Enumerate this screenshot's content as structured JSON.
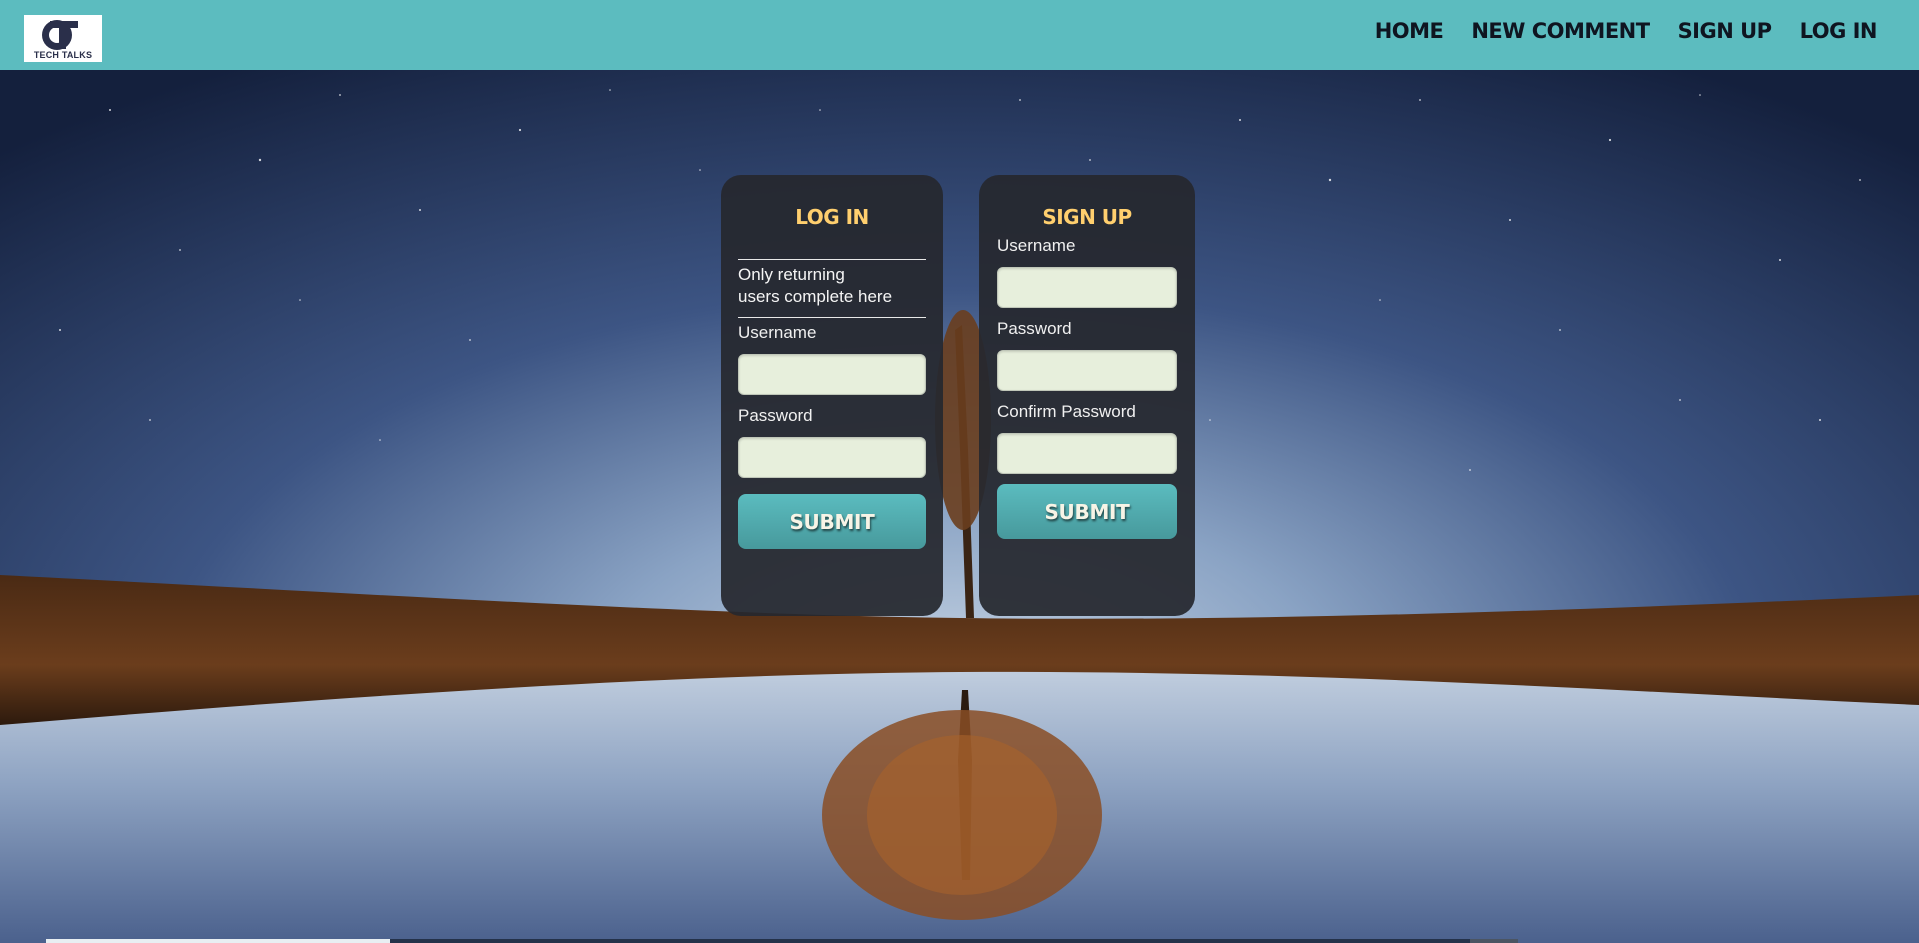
{
  "brand": {
    "logo_text": "TECH TALKS",
    "header_color": "#5cbcbf"
  },
  "nav": {
    "items": [
      {
        "label": "HOME"
      },
      {
        "label": "NEW COMMENT"
      },
      {
        "label": "SIGN UP"
      },
      {
        "label": "LOG IN"
      }
    ]
  },
  "login": {
    "title": "LOG IN",
    "note_line1": "Only returning",
    "note_line2": "users complete here",
    "username_label": "Username",
    "username_value": "",
    "password_label": "Password",
    "password_value": "",
    "submit_label": "SUBMIT"
  },
  "signup": {
    "title": "SIGN UP",
    "username_label": "Username",
    "username_value": "",
    "password_label": "Password",
    "password_value": "",
    "confirm_label": "Confirm Password",
    "confirm_value": "",
    "submit_label": "SUBMIT"
  },
  "colors": {
    "accent_title": "#ffcf6e",
    "button": "#5bbcbf",
    "input_bg": "#e7efdc",
    "card_bg": "#26282e"
  },
  "background": {
    "description_icon": "night-sky-lake-tree-image"
  }
}
